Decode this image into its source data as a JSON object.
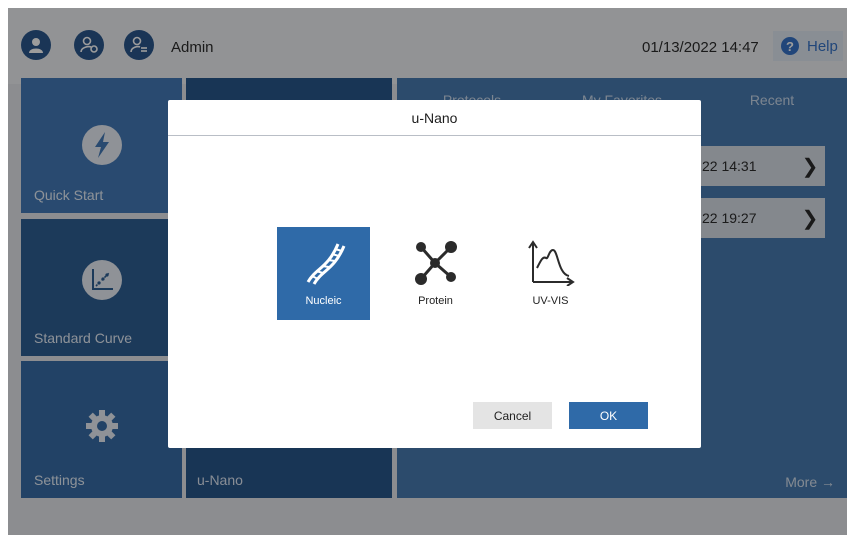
{
  "header": {
    "user_icons": [
      "user-icon",
      "user-settings-icon",
      "user-list-icon"
    ],
    "admin_name": "Admin",
    "datetime": "01/13/2022 14:47",
    "help_label": "Help"
  },
  "tiles": {
    "quick_start": "Quick Start",
    "standard_curve": "Standard Curve",
    "settings": "Settings"
  },
  "center_panel": {
    "label": "u-Nano"
  },
  "right_panel": {
    "tabs": [
      "Protocols",
      "My Favorites",
      "Recent"
    ],
    "recent_rows": [
      {
        "time": "22 14:31"
      },
      {
        "time": "22 19:27"
      }
    ],
    "more_label": "More  →"
  },
  "dialog": {
    "title": "u-Nano",
    "modes": [
      {
        "label": "Nucleic",
        "icon": "dna-icon",
        "selected": true
      },
      {
        "label": "Protein",
        "icon": "protein-molecule-icon",
        "selected": false
      },
      {
        "label": "UV-VIS",
        "icon": "spectrum-chart-icon",
        "selected": false
      }
    ],
    "cancel_label": "Cancel",
    "ok_label": "OK"
  },
  "colors": {
    "primary": "#2f6aa8",
    "dark_blue": "#1d4e86",
    "help_blue": "#2b6cc4"
  }
}
